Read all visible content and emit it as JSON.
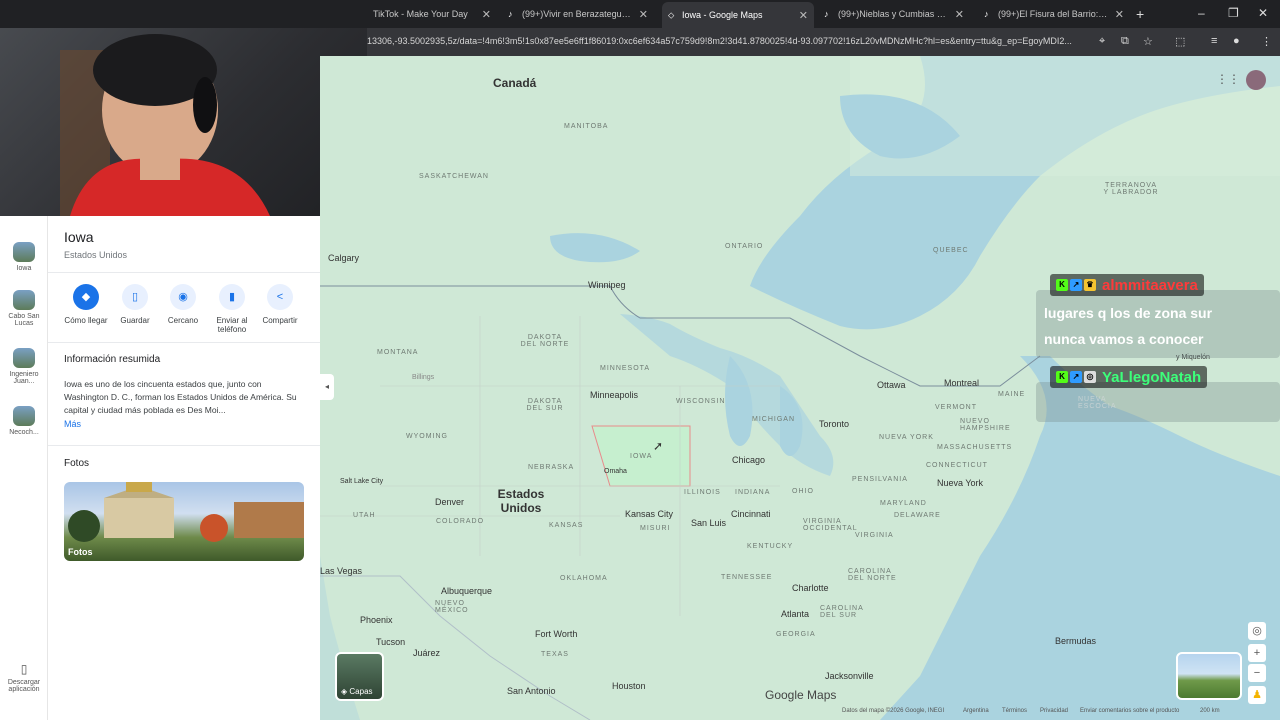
{
  "browser": {
    "tabs": [
      {
        "title": "TikTok - Make Your Day",
        "active": false
      },
      {
        "title": "(99+)Vivir en Berazategui Des",
        "active": false
      },
      {
        "title": "Iowa - Google Maps",
        "active": true
      },
      {
        "title": "(99+)Nieblas y Cumbias en Bu",
        "active": false
      },
      {
        "title": "(99+)El Fisura del Barrio: Una C",
        "active": false
      }
    ],
    "url": "13306,-93.5002935,5z/data=!4m6!3m5!1s0x87ee5e6ff1f86019:0xc6ef634a57c759d9!8m2!3d41.8780025!4d-93.097702!16zL20vMDNzMHc?hl=es&entry=ttu&g_ep=EgoyMDI2..."
  },
  "rail": {
    "items": [
      {
        "label": "Iowa"
      },
      {
        "label": "Cabo San Lucas"
      },
      {
        "label": "Ingeniero Juan..."
      },
      {
        "label": "Necoch..."
      },
      {
        "label": "Descargar aplicación"
      }
    ]
  },
  "place": {
    "title": "Iowa",
    "subtitle": "Estados Unidos",
    "actions": [
      {
        "label": "Cómo llegar",
        "icon": "directions-icon"
      },
      {
        "label": "Guardar",
        "icon": "bookmark-icon"
      },
      {
        "label": "Cercano",
        "icon": "nearby-icon"
      },
      {
        "label": "Enviar al teléfono",
        "icon": "phone-icon"
      },
      {
        "label": "Compartir",
        "icon": "share-icon"
      }
    ],
    "summary_title": "Información resumida",
    "summary_text": "Iowa es uno de los cincuenta estados que, junto con Washington D. C., forman los Estados Unidos de América. Su capital y ciudad más poblada es Des Moi...",
    "more_label": "Más",
    "photos_title": "Fotos",
    "photo_label": "Fotos"
  },
  "map": {
    "labels": {
      "canada": "Canadá",
      "manitoba": "MANITOBA",
      "saskatchewan": "SASKATCHEWAN",
      "ontario": "ONTARIO",
      "quebec": "QUEBEC",
      "terranova": "TERRANOVA\nY LABRADOR",
      "calgary": "Calgary",
      "winnipeg": "Winnipeg",
      "dakota_norte": "DAKOTA\nDEL NORTE",
      "dakota_sur": "DAKOTA\nDEL SUR",
      "montana": "MONTANA",
      "billings": "Billings",
      "minnesota": "MINNESOTA",
      "minneapolis": "Minneapolis",
      "wisconsin": "WISCONSIN",
      "michigan": "MICHIGAN",
      "wyoming": "WYOMING",
      "iowa": "IOWA",
      "omaha": "Omaha",
      "nebraska": "NEBRASKA",
      "chicago": "Chicago",
      "toronto": "Toronto",
      "ottawa": "Ottawa",
      "montreal": "Montreal",
      "maine": "MAINE",
      "vermont": "VERMONT",
      "nueva_york_st": "NUEVA YORK",
      "nuevo_hampshire": "NUEVO\nHAMPSHIRE",
      "massachusetts": "MASSACHUSETTS",
      "connecticut": "CONNECTICUT",
      "nueva_york": "Nueva York",
      "pensilvania": "PENSILVANIA",
      "ohio": "OHIO",
      "indiana": "INDIANA",
      "illinois": "ILLINOIS",
      "salt_lake": "Salt Lake City",
      "utah": "UTAH",
      "denver": "Denver",
      "colorado": "COLORADO",
      "estados_unidos": "Estados\nUnidos",
      "kansas": "KANSAS",
      "kansas_city": "Kansas City",
      "misuri": "MISURI",
      "san_luis": "San Luis",
      "cincinnati": "Cincinnati",
      "kentucky": "KENTUCKY",
      "virginia_occ": "VIRGINIA\nOCCIDENTAL",
      "virginia": "VIRGINIA",
      "maryland": "MARYLAND",
      "delaware": "DELAWARE",
      "las_vegas": "Las Vegas",
      "albuquerque": "Albuquerque",
      "nuevo_mexico": "NUEVO\nMÉXICO",
      "oklahoma": "OKLAHOMA",
      "tennessee": "TENNESSEE",
      "charlotte": "Charlotte",
      "carolina_norte": "CAROLINA\nDEL NORTE",
      "carolina_sur": "CAROLINA\nDEL SUR",
      "atlanta": "Atlanta",
      "georgia": "GEORGIA",
      "phoenix": "Phoenix",
      "tucson": "Tucson",
      "fort_worth": "Fort Worth",
      "texas": "TEXAS",
      "juarez": "Juárez",
      "san_antonio": "San Antonio",
      "houston": "Houston",
      "jacksonville": "Jacksonville",
      "bermudas": "Bermudas",
      "nueva_escocia": "NUEVA\nESCOCIA",
      "san_pedro": "y Miquelón",
      "google_maps": "Google Maps",
      "attrib_data": "Datos del mapa ©2026 Google, INEGI",
      "attrib_country": "Argentina",
      "attrib_terms": "Términos",
      "attrib_privacy": "Privacidad",
      "attrib_feedback": "Enviar comentarios sobre el producto",
      "attrib_scale": "200 km"
    },
    "layers_label": "Capas"
  },
  "chat": {
    "user1": "almmitaavera",
    "user1_color": "#ff3a3a",
    "message1_line1": "lugares q los de zona sur",
    "message1_line2": "nunca vamos a conocer",
    "user2": "YaLlegoNatah",
    "user2_color": "#3cff7a"
  },
  "colors": {
    "accent": "#1a73e8",
    "land": "#cfe8d6",
    "water": "#aad3df",
    "iowa_highlight": "#c6efcf"
  }
}
